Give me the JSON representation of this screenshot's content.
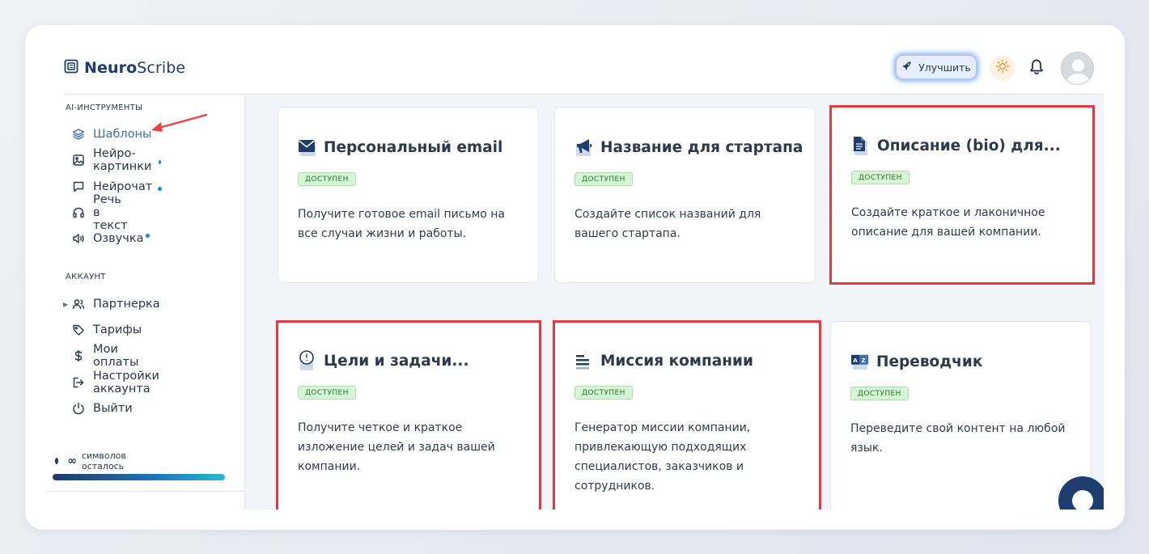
{
  "header": {
    "logo_bold": "Neuro",
    "logo_rest": "Scribe",
    "upgrade_label": "Улучшить"
  },
  "sidebar": {
    "tools_label": "AI-ИНСТРУМЕНТЫ",
    "tools": [
      {
        "label": "Шаблоны",
        "icon": "layers-icon",
        "active": true
      },
      {
        "label": "Нейро-картинки",
        "icon": "image-icon",
        "dot": true
      },
      {
        "label": "Нейрочат",
        "icon": "chat-icon",
        "dot": true
      },
      {
        "label": "Речь в текст",
        "icon": "headphones-icon"
      },
      {
        "label": "Озвучка",
        "icon": "speaker-icon",
        "dot": true
      }
    ],
    "account_label": "АККАУНТ",
    "account": [
      {
        "label": "Партнерка",
        "icon": "users-icon"
      },
      {
        "label": "Тарифы",
        "icon": "tag-icon"
      },
      {
        "label": "Мои оплаты",
        "icon": "dollar-icon"
      },
      {
        "label": "Настройки аккаунта",
        "icon": "logout-arrow-icon"
      },
      {
        "label": "Выйти",
        "icon": "power-icon"
      }
    ],
    "symbols_value": "∞",
    "symbols_label": "символов осталось"
  },
  "cards": [
    {
      "title": "Персональный email",
      "badge": "ДОСТУПЕН",
      "desc": "Получите готовое email письмо на все случаи жизни и работы.",
      "icon": "envelope-icon"
    },
    {
      "title": "Название для стартапа",
      "badge": "ДОСТУПЕН",
      "desc": "Создайте список названий для вашего стартапа.",
      "icon": "megaphone-icon"
    },
    {
      "title": "Описание (bio) для...",
      "badge": "ДОСТУПЕН",
      "desc": "Создайте краткое и лаконичное описание для вашей компании.",
      "icon": "document-icon"
    },
    {
      "title": "Цели и задачи...",
      "badge": "ДОСТУПЕН",
      "desc": "Получите четкое и краткое изложение целей и задач вашей компании.",
      "icon": "clock-note-icon"
    },
    {
      "title": "Миссия компании",
      "badge": "ДОСТУПЕН",
      "desc": "Генератор миссии компании, привлекающую подходящих специалистов, заказчиков и сотрудников.",
      "icon": "text-lines-icon"
    },
    {
      "title": "Переводчик",
      "badge": "ДОСТУПЕН",
      "desc": "Переведите свой контент на любой язык.",
      "icon": "translate-icon"
    }
  ],
  "colors": {
    "accent": "#1f3d6b",
    "active_nav": "#3e6fb0",
    "highlight": "#e23b3f",
    "badge_bg": "#d6f5d6",
    "arrow": "#e84444"
  }
}
